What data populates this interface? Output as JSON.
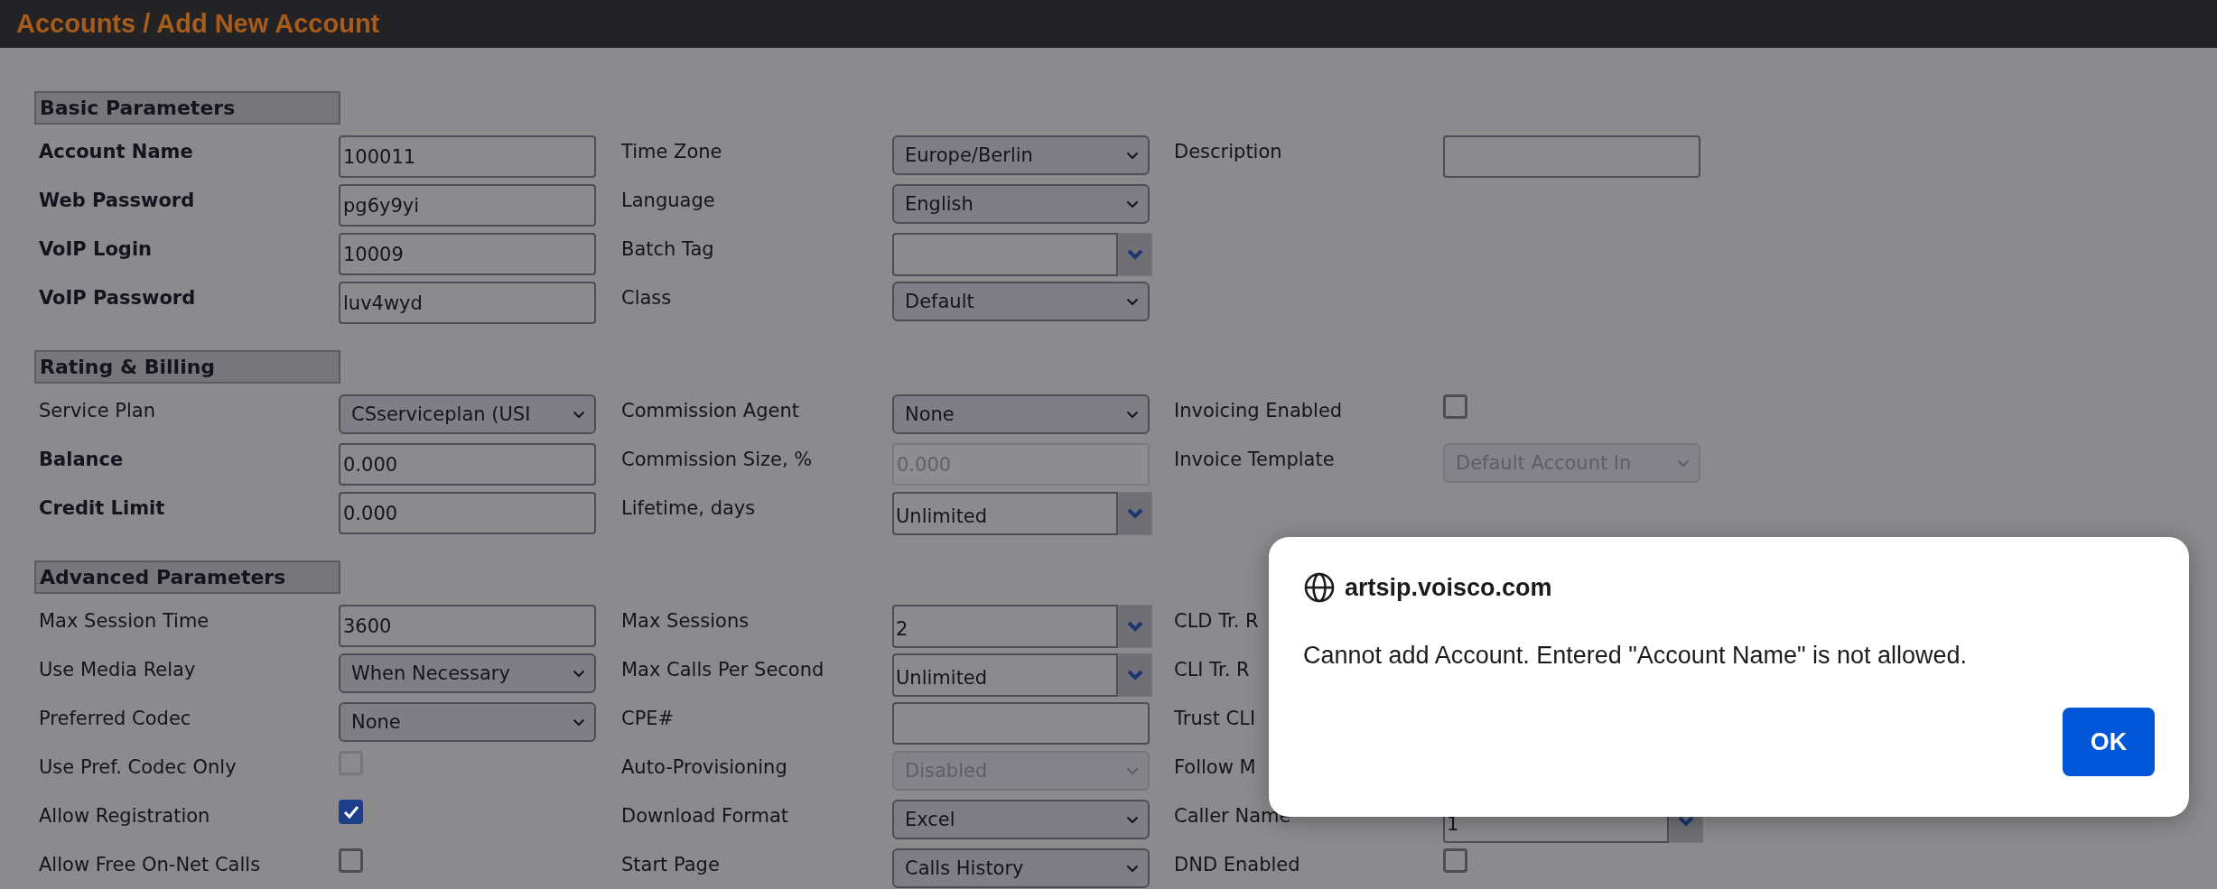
{
  "header": {
    "title": "Accounts / Add New Account"
  },
  "sections": [
    {
      "title": "Basic Parameters",
      "rows": [
        [
          {
            "label": "Account Name",
            "bold": true,
            "field": {
              "kind": "text",
              "value": "100011",
              "disabled": false
            }
          },
          {
            "label": "Time Zone",
            "bold": false,
            "field": {
              "kind": "select",
              "value": "Europe/Berlin",
              "disabled": false
            }
          },
          {
            "label": "Description",
            "bold": false,
            "field": {
              "kind": "text",
              "disabled": false
            }
          }
        ],
        [
          {
            "label": "Web Password",
            "bold": true,
            "field": {
              "kind": "text",
              "value": "pg6y9yi",
              "disabled": false
            }
          },
          {
            "label": "Language",
            "bold": false,
            "field": {
              "kind": "select",
              "value": "English",
              "disabled": false
            }
          }
        ],
        [
          {
            "label": "VoIP Login",
            "bold": true,
            "field": {
              "kind": "text",
              "value": "10009",
              "disabled": false
            }
          },
          {
            "label": "Batch Tag",
            "bold": false,
            "field": {
              "kind": "combo",
              "disabled": false
            }
          }
        ],
        [
          {
            "label": "VoIP Password",
            "bold": true,
            "field": {
              "kind": "text",
              "value": "luv4wyd",
              "disabled": false
            }
          },
          {
            "label": "Class",
            "bold": false,
            "field": {
              "kind": "select",
              "value": "Default",
              "disabled": false
            }
          }
        ]
      ]
    },
    {
      "title": "Rating & Billing",
      "rows": [
        [
          {
            "label": "Service Plan",
            "bold": false,
            "field": {
              "kind": "select",
              "value": "CSserviceplan (USI",
              "disabled": false
            }
          },
          {
            "label": "Commission Agent",
            "bold": false,
            "field": {
              "kind": "select",
              "value": "None",
              "disabled": false
            }
          },
          {
            "label": "Invoicing Enabled",
            "bold": false,
            "field": {
              "kind": "checkbox",
              "checked": false,
              "disabled": false
            }
          }
        ],
        [
          {
            "label": "Balance",
            "bold": true,
            "field": {
              "kind": "text",
              "value": "0.000",
              "disabled": false
            }
          },
          {
            "label": "Commission Size, %",
            "bold": false,
            "field": {
              "kind": "text",
              "value": "0.000",
              "disabled": true
            }
          },
          {
            "label": "Invoice Template",
            "bold": false,
            "field": {
              "kind": "select",
              "value": "Default Account In",
              "disabled": true
            }
          }
        ],
        [
          {
            "label": "Credit Limit",
            "bold": true,
            "field": {
              "kind": "text",
              "value": "0.000",
              "disabled": false
            }
          },
          {
            "label": "Lifetime, days",
            "bold": false,
            "field": {
              "kind": "combo",
              "value": "Unlimited",
              "disabled": false
            }
          }
        ]
      ]
    },
    {
      "title": "Advanced Parameters",
      "rows": [
        [
          {
            "label": "Max Session Time",
            "bold": false,
            "field": {
              "kind": "text",
              "value": "3600",
              "disabled": false
            }
          },
          {
            "label": "Max Sessions",
            "bold": false,
            "field": {
              "kind": "combo",
              "value": "2",
              "disabled": false
            }
          },
          {
            "label": "CLD Tr. R",
            "bold": false
          }
        ],
        [
          {
            "label": "Use Media Relay",
            "bold": false,
            "field": {
              "kind": "select",
              "value": "When Necessary",
              "disabled": false
            }
          },
          {
            "label": "Max Calls Per Second",
            "bold": false,
            "field": {
              "kind": "combo",
              "value": "Unlimited",
              "disabled": false
            }
          },
          {
            "label": "CLI Tr. R",
            "bold": false
          }
        ],
        [
          {
            "label": "Preferred Codec",
            "bold": false,
            "field": {
              "kind": "select",
              "value": "None",
              "disabled": false
            }
          },
          {
            "label": "CPE#",
            "bold": false,
            "field": {
              "kind": "text",
              "disabled": false
            }
          },
          {
            "label": "Trust CLI",
            "bold": false
          }
        ],
        [
          {
            "label": "Use Pref. Codec Only",
            "bold": false,
            "field": {
              "kind": "checkbox",
              "checked": false,
              "disabled": true
            }
          },
          {
            "label": "Auto-Provisioning",
            "bold": false,
            "field": {
              "kind": "select",
              "value": "Disabled",
              "disabled": true
            }
          },
          {
            "label": "Follow M",
            "bold": false
          }
        ],
        [
          {
            "label": "Allow Registration",
            "bold": false,
            "field": {
              "kind": "checkbox",
              "checked": true,
              "disabled": false
            }
          },
          {
            "label": "Download Format",
            "bold": false,
            "field": {
              "kind": "select",
              "value": "Excel",
              "disabled": false
            }
          },
          {
            "label": "Caller Name",
            "bold": false,
            "field": {
              "kind": "combo",
              "value": "1",
              "disabled": false
            }
          }
        ],
        [
          {
            "label": "Allow Free On-Net Calls",
            "bold": false,
            "field": {
              "kind": "checkbox",
              "checked": false,
              "disabled": false
            }
          },
          {
            "label": "Start Page",
            "bold": false,
            "field": {
              "kind": "select",
              "value": "Calls History",
              "disabled": false
            }
          },
          {
            "label": "DND Enabled",
            "bold": false,
            "field": {
              "kind": "checkbox",
              "checked": false,
              "disabled": false
            }
          }
        ]
      ]
    }
  ],
  "dialog": {
    "origin": "artsip.voisco.com",
    "message": "Cannot add Account. Entered \"Account Name\" is not allowed.",
    "button": "OK"
  }
}
